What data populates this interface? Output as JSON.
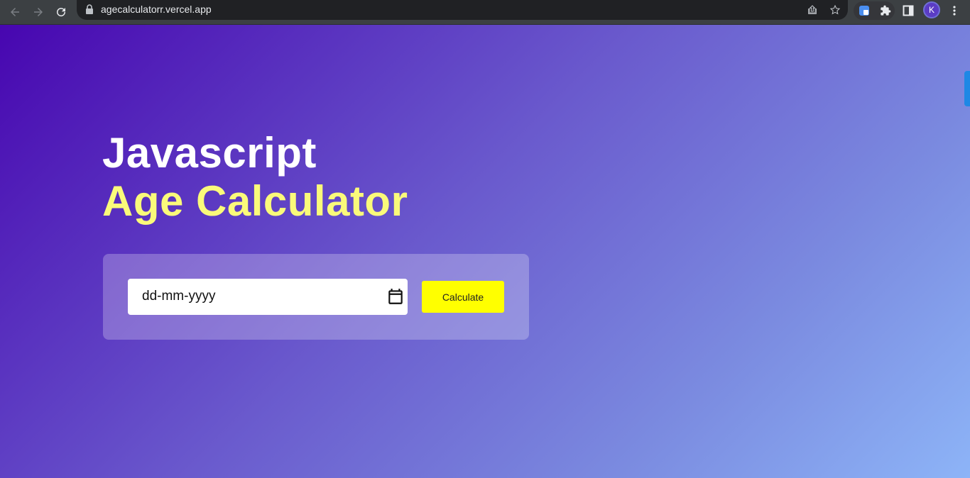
{
  "browser": {
    "url": "agecalculatorr.vercel.app",
    "avatar_letter": "K"
  },
  "page": {
    "title_line1": "Javascript",
    "title_line2": "Age Calculator",
    "date_placeholder": "dd-mm-yyyy",
    "calculate_label": "Calculate"
  },
  "colors": {
    "title_line1": "#ffffff",
    "title_line2": "#fafa7a",
    "button_bg": "#ffff00",
    "gradient_start": "#4706b0",
    "gradient_end": "#8db4f7"
  },
  "icons": {
    "back": "back-arrow-icon",
    "forward": "forward-arrow-icon",
    "reload": "reload-icon",
    "lock": "lock-icon",
    "share": "share-icon",
    "bookmark": "star-icon",
    "extension": "puzzle-icon",
    "sidepanel": "side-panel-icon",
    "menu": "kebab-menu-icon",
    "calendar": "calendar-icon"
  }
}
